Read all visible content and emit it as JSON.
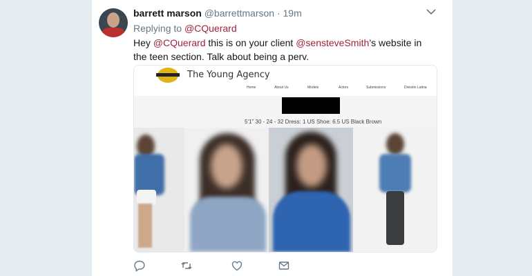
{
  "tweet": {
    "display_name": "barrett marson",
    "handle": "@barrettmarson",
    "separator": "·",
    "time": "19m",
    "replying_prefix": "Replying to",
    "replying_to": "@CQuerard",
    "body": {
      "part1": "Hey ",
      "mention1": "@CQuerard",
      "part2": " this is on your client ",
      "mention2": "@sensteveSmith",
      "part3": "’s website in the teen section. Talk about being a perv."
    }
  },
  "screenshot": {
    "site_title": "The Young Agency",
    "nav": [
      "Home",
      "About Us",
      "Models",
      "Actors",
      "Submissions",
      "División Latina"
    ],
    "stats": "5'1\"   30 - 24 - 32   Dress: 1 US   Shoe: 6.5 US   Black   Brown"
  },
  "actions": [
    "reply-icon",
    "retweet-icon",
    "like-icon",
    "message-icon"
  ],
  "colors": {
    "link": "#a0223b",
    "muted": "#657786",
    "background": "#e6ecf0"
  }
}
